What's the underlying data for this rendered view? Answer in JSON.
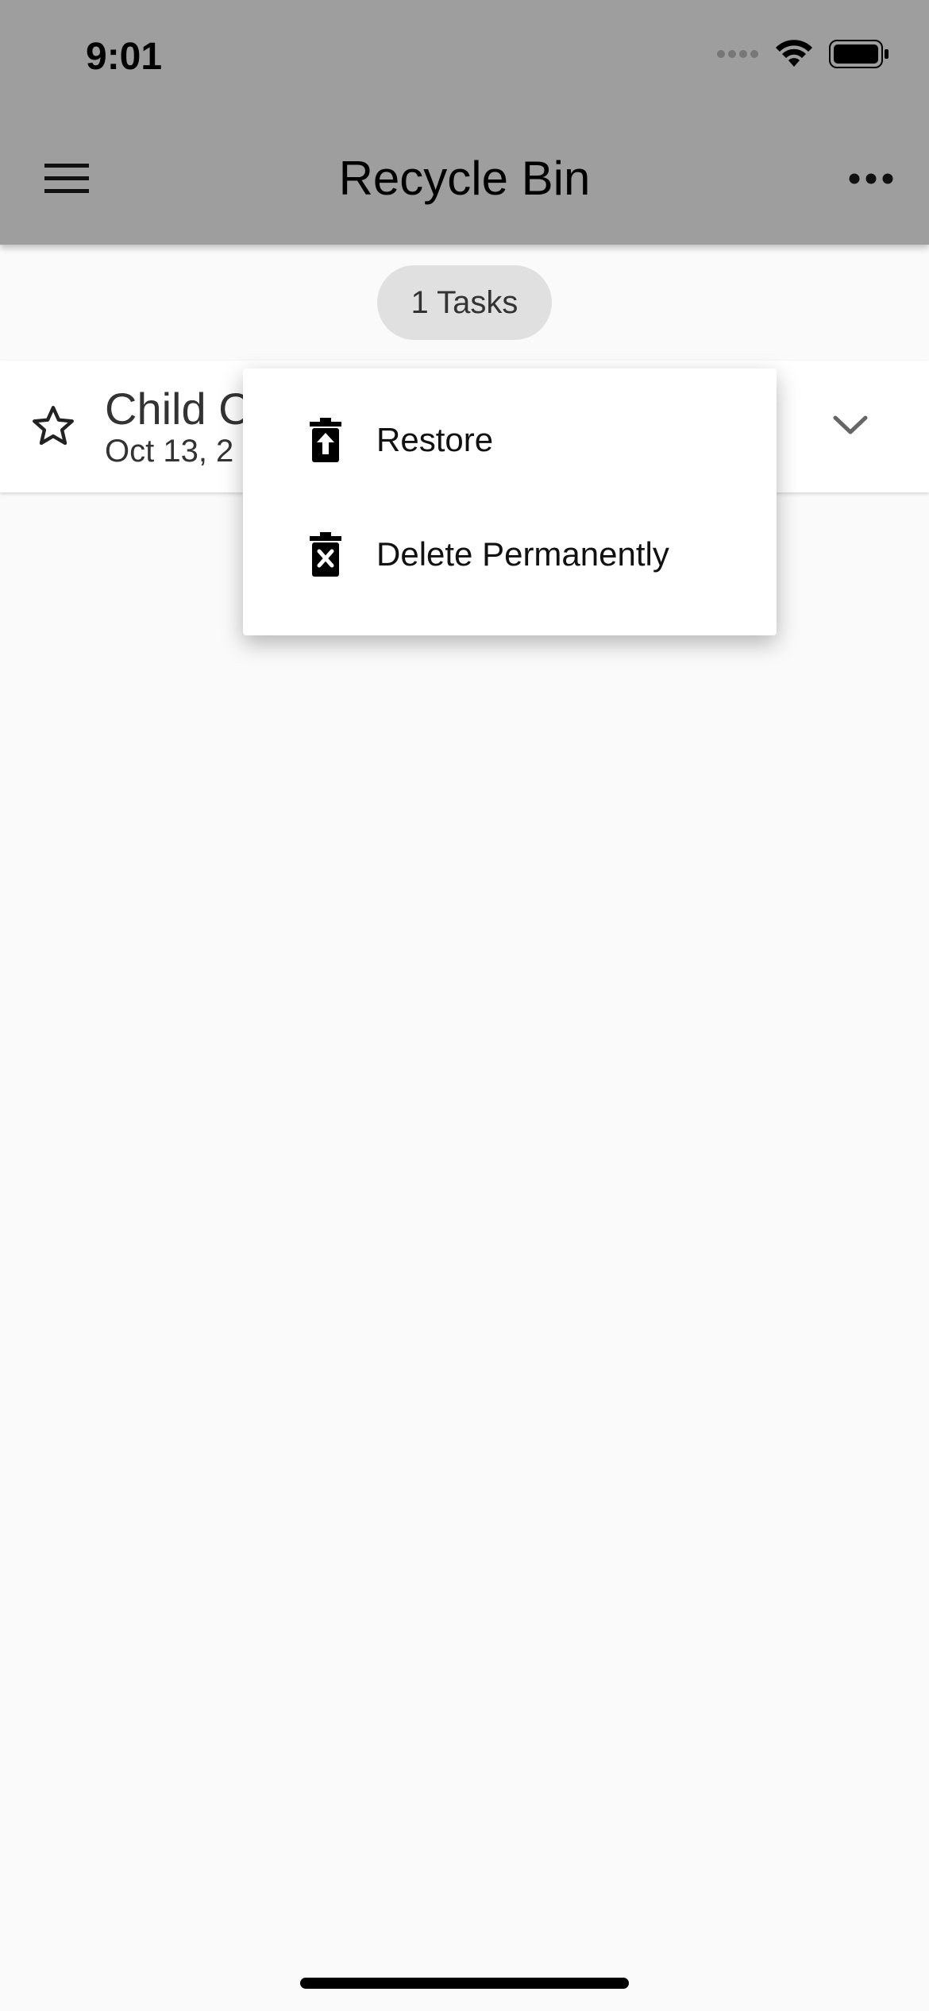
{
  "status_bar": {
    "time": "9:01"
  },
  "app_bar": {
    "title": "Recycle Bin",
    "menu_icon": "hamburger-menu-icon",
    "more_icon": "more-horizontal-icon"
  },
  "summary": {
    "count_label": "1 Tasks"
  },
  "tasks": [
    {
      "title": "Child C",
      "date": "Oct 13, 2",
      "starred": false
    }
  ],
  "context_menu": {
    "items": [
      {
        "label": "Restore",
        "icon": "trash-restore-icon"
      },
      {
        "label": "Delete Permanently",
        "icon": "trash-delete-icon"
      }
    ]
  },
  "colors": {
    "header_bg": "#9e9e9e",
    "page_bg": "#fafafa",
    "chip_bg": "#e0e0e0"
  }
}
